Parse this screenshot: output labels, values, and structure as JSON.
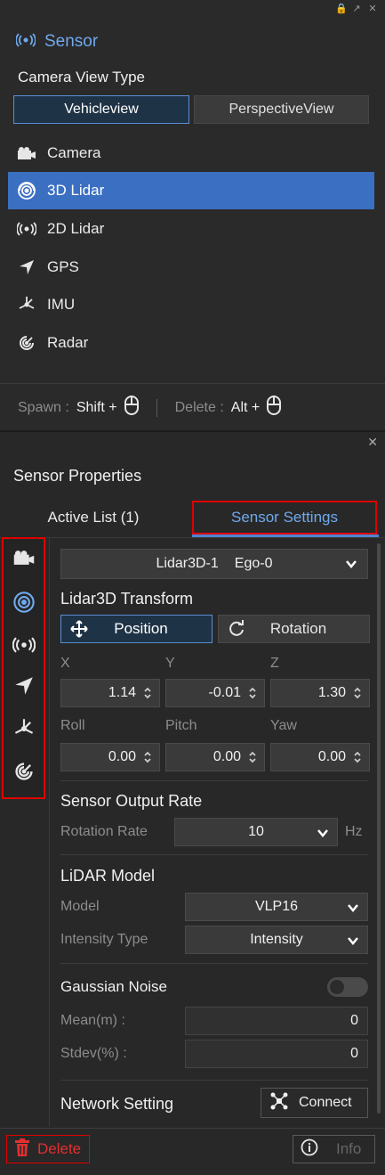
{
  "sensor_panel": {
    "title": "Sensor",
    "camera_view_type_label": "Camera View Type",
    "view_options": [
      "Vehicleview",
      "PerspectiveView"
    ],
    "sensor_list": [
      {
        "label": "Camera",
        "icon": "camera-icon",
        "selected": false
      },
      {
        "label": "3D Lidar",
        "icon": "lidar3d-icon",
        "selected": true
      },
      {
        "label": "2D Lidar",
        "icon": "lidar2d-icon",
        "selected": false
      },
      {
        "label": "GPS",
        "icon": "gps-icon",
        "selected": false
      },
      {
        "label": "IMU",
        "icon": "imu-icon",
        "selected": false
      },
      {
        "label": "Radar",
        "icon": "radar-icon",
        "selected": false
      }
    ],
    "shortcuts": {
      "spawn_label": "Spawn :",
      "spawn_key": "Shift +",
      "delete_label": "Delete :",
      "delete_key": "Alt +"
    }
  },
  "properties_panel": {
    "title": "Sensor Properties",
    "tabs": [
      "Active List  (1)",
      "Sensor Settings"
    ],
    "sensor_select": {
      "name": "Lidar3D-1",
      "owner": "Ego-0"
    },
    "transform": {
      "title": "Lidar3D Transform",
      "position_label": "Position",
      "rotation_label": "Rotation",
      "pos_labels": [
        "X",
        "Y",
        "Z"
      ],
      "pos_values": [
        "1.14",
        "-0.01",
        "1.30"
      ],
      "rot_labels": [
        "Roll",
        "Pitch",
        "Yaw"
      ],
      "rot_values": [
        "0.00",
        "0.00",
        "0.00"
      ]
    },
    "output_rate": {
      "title": "Sensor Output Rate",
      "label": "Rotation Rate",
      "value": "10",
      "unit": "Hz"
    },
    "lidar_model": {
      "title": "LiDAR Model",
      "model_label": "Model",
      "model_value": "VLP16",
      "intensity_label": "Intensity Type",
      "intensity_value": "Intensity"
    },
    "noise": {
      "title": "Gaussian Noise",
      "mean_label": "Mean(m) :",
      "mean_value": "0",
      "stdev_label": "Stdev(%) :",
      "stdev_value": "0"
    },
    "network": {
      "title": "Network Setting",
      "connect_label": "Connect"
    },
    "footer": {
      "delete_label": "Delete",
      "info_label": "Info"
    }
  },
  "colors": {
    "accent": "#6fa9ee",
    "selected": "#3b6fc2",
    "highlight_box": "#e00000",
    "delete": "#e23030"
  }
}
